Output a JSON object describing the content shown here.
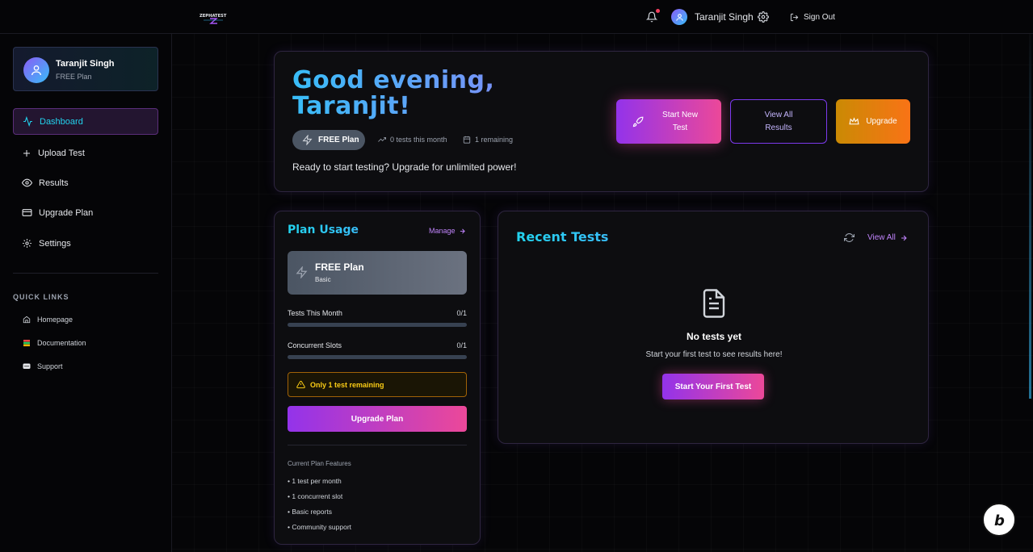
{
  "header": {
    "logo_text": "ZEPHATEST",
    "user_name": "Taranjit Singh",
    "sign_out_label": "Sign Out"
  },
  "sidebar": {
    "profile": {
      "name": "Taranjit Singh",
      "plan": "FREE Plan"
    },
    "nav": [
      {
        "label": "Dashboard",
        "icon": "activity-icon",
        "active": true
      },
      {
        "label": "Upload Test",
        "icon": "plus-icon"
      },
      {
        "label": "Results",
        "icon": "eye-icon"
      },
      {
        "label": "Upgrade Plan",
        "icon": "credit-card-icon"
      },
      {
        "label": "Settings",
        "icon": "gear-icon"
      }
    ],
    "quick_links_title": "QUICK LINKS",
    "quick_links": [
      {
        "label": "Homepage",
        "icon": "home-icon"
      },
      {
        "label": "Documentation",
        "icon": "books-icon"
      },
      {
        "label": "Support",
        "icon": "chat-icon"
      }
    ]
  },
  "hero": {
    "title": "Good evening, Taranjit!",
    "plan_pill": "FREE Plan",
    "tests_this_month": "0 tests this month",
    "remaining": "1 remaining",
    "subtitle": "Ready to start testing? Upgrade for unlimited power!",
    "btn_start": "Start New Test",
    "btn_view_all": "View All Results",
    "btn_upgrade": "Upgrade"
  },
  "plan_usage": {
    "title": "Plan Usage",
    "manage_label": "Manage",
    "plan_name": "FREE Plan",
    "plan_tier": "Basic",
    "tests_label": "Tests This Month",
    "tests_value": "0/1",
    "tests_progress": 0,
    "slots_label": "Concurrent Slots",
    "slots_value": "0/1",
    "slots_progress": 0,
    "warning": "Only 1 test remaining",
    "upgrade_btn": "Upgrade Plan",
    "features_title": "Current Plan Features",
    "features": [
      "1 test per month",
      "1 concurrent slot",
      "Basic reports",
      "Community support"
    ]
  },
  "recent_tests": {
    "title": "Recent Tests",
    "view_all_label": "View All",
    "empty_title": "No tests yet",
    "empty_subtitle": "Start your first test to see results here!",
    "empty_btn": "Start Your First Test"
  },
  "colors": {
    "accent_cyan": "#22d3ee",
    "accent_purple": "#9333ea",
    "accent_pink": "#ec4899",
    "warning": "#facc15"
  }
}
